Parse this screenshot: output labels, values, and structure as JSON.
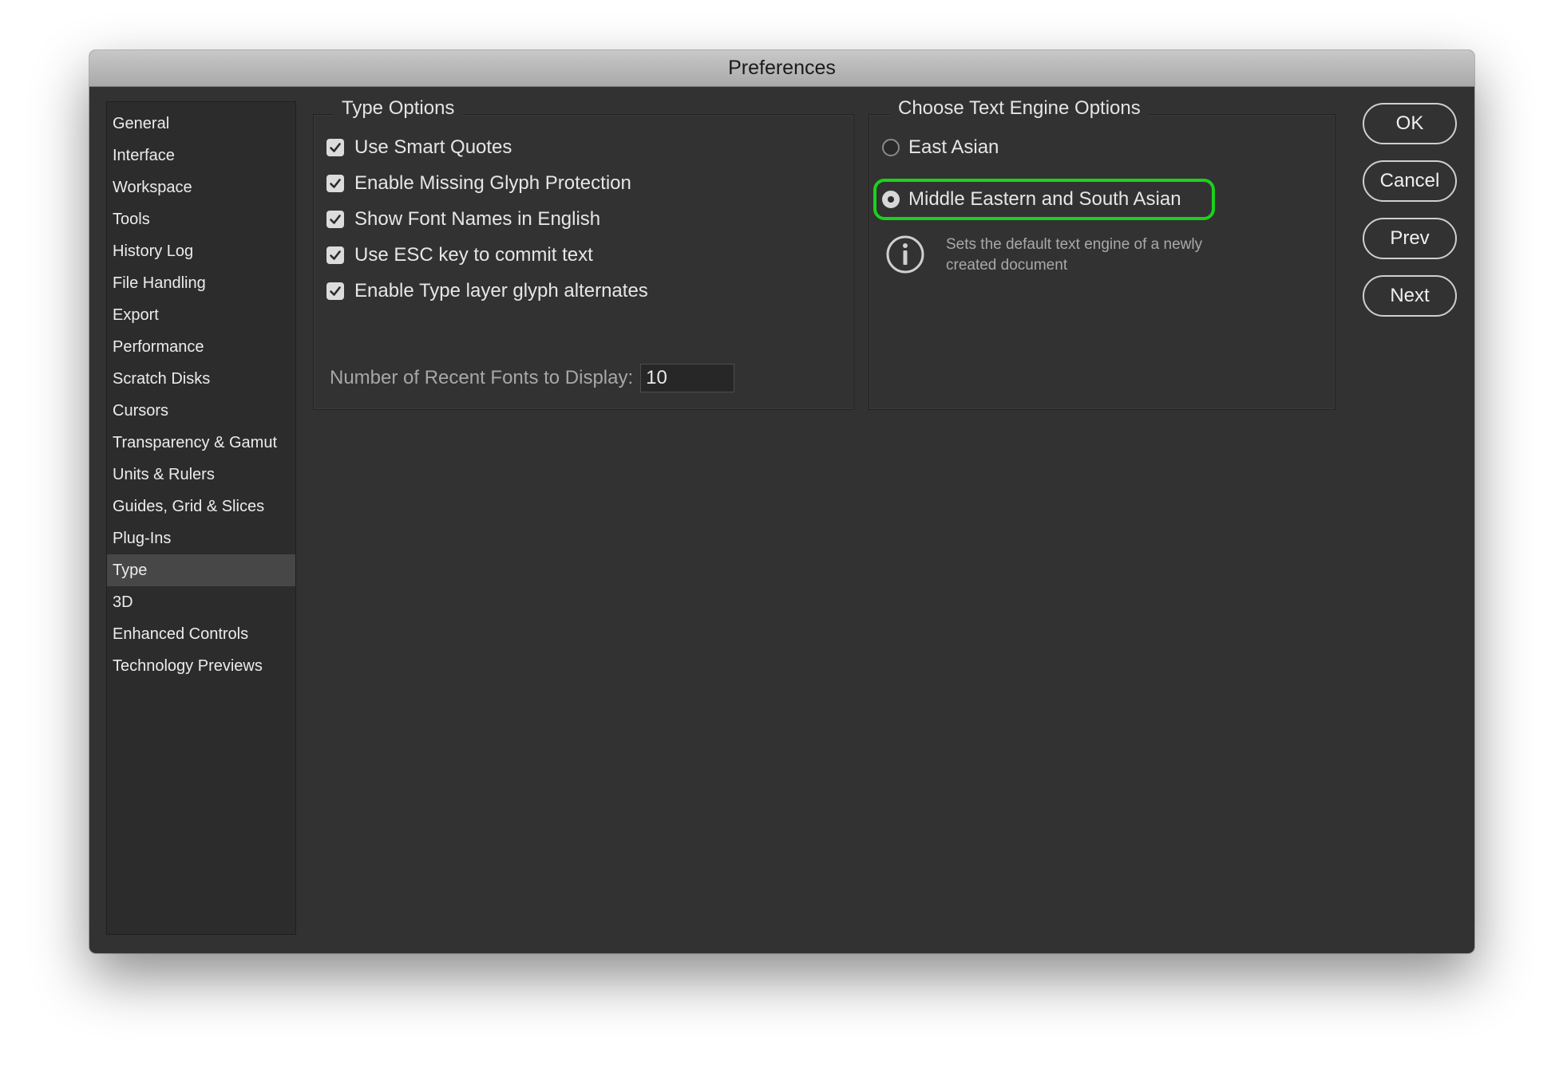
{
  "window": {
    "title": "Preferences"
  },
  "sidebar": {
    "items": [
      {
        "label": "General"
      },
      {
        "label": "Interface"
      },
      {
        "label": "Workspace"
      },
      {
        "label": "Tools"
      },
      {
        "label": "History Log"
      },
      {
        "label": "File Handling"
      },
      {
        "label": "Export"
      },
      {
        "label": "Performance"
      },
      {
        "label": "Scratch Disks"
      },
      {
        "label": "Cursors"
      },
      {
        "label": "Transparency & Gamut"
      },
      {
        "label": "Units & Rulers"
      },
      {
        "label": "Guides, Grid & Slices"
      },
      {
        "label": "Plug-Ins"
      },
      {
        "label": "Type",
        "selected": true
      },
      {
        "label": "3D"
      },
      {
        "label": "Enhanced Controls"
      },
      {
        "label": "Technology Previews"
      }
    ]
  },
  "type_options": {
    "title": "Type Options",
    "checkboxes": [
      {
        "label": "Use Smart Quotes",
        "checked": true
      },
      {
        "label": "Enable Missing Glyph Protection",
        "checked": true
      },
      {
        "label": "Show Font Names in English",
        "checked": true
      },
      {
        "label": "Use ESC key to commit text",
        "checked": true
      },
      {
        "label": "Enable Type layer glyph alternates",
        "checked": true
      }
    ],
    "recent_fonts": {
      "label": "Number of Recent Fonts to Display:",
      "value": "10"
    }
  },
  "text_engine": {
    "title": "Choose Text Engine Options",
    "options": [
      {
        "label": "East Asian",
        "selected": false
      },
      {
        "label": "Middle Eastern and South Asian",
        "selected": true
      }
    ],
    "info": "Sets the default text engine of a newly created document",
    "highlight_color": "#1bd11b"
  },
  "buttons": {
    "ok": "OK",
    "cancel": "Cancel",
    "prev": "Prev",
    "next": "Next"
  },
  "icons": {
    "checkbox": "checkmark-icon",
    "info": "info-icon"
  }
}
